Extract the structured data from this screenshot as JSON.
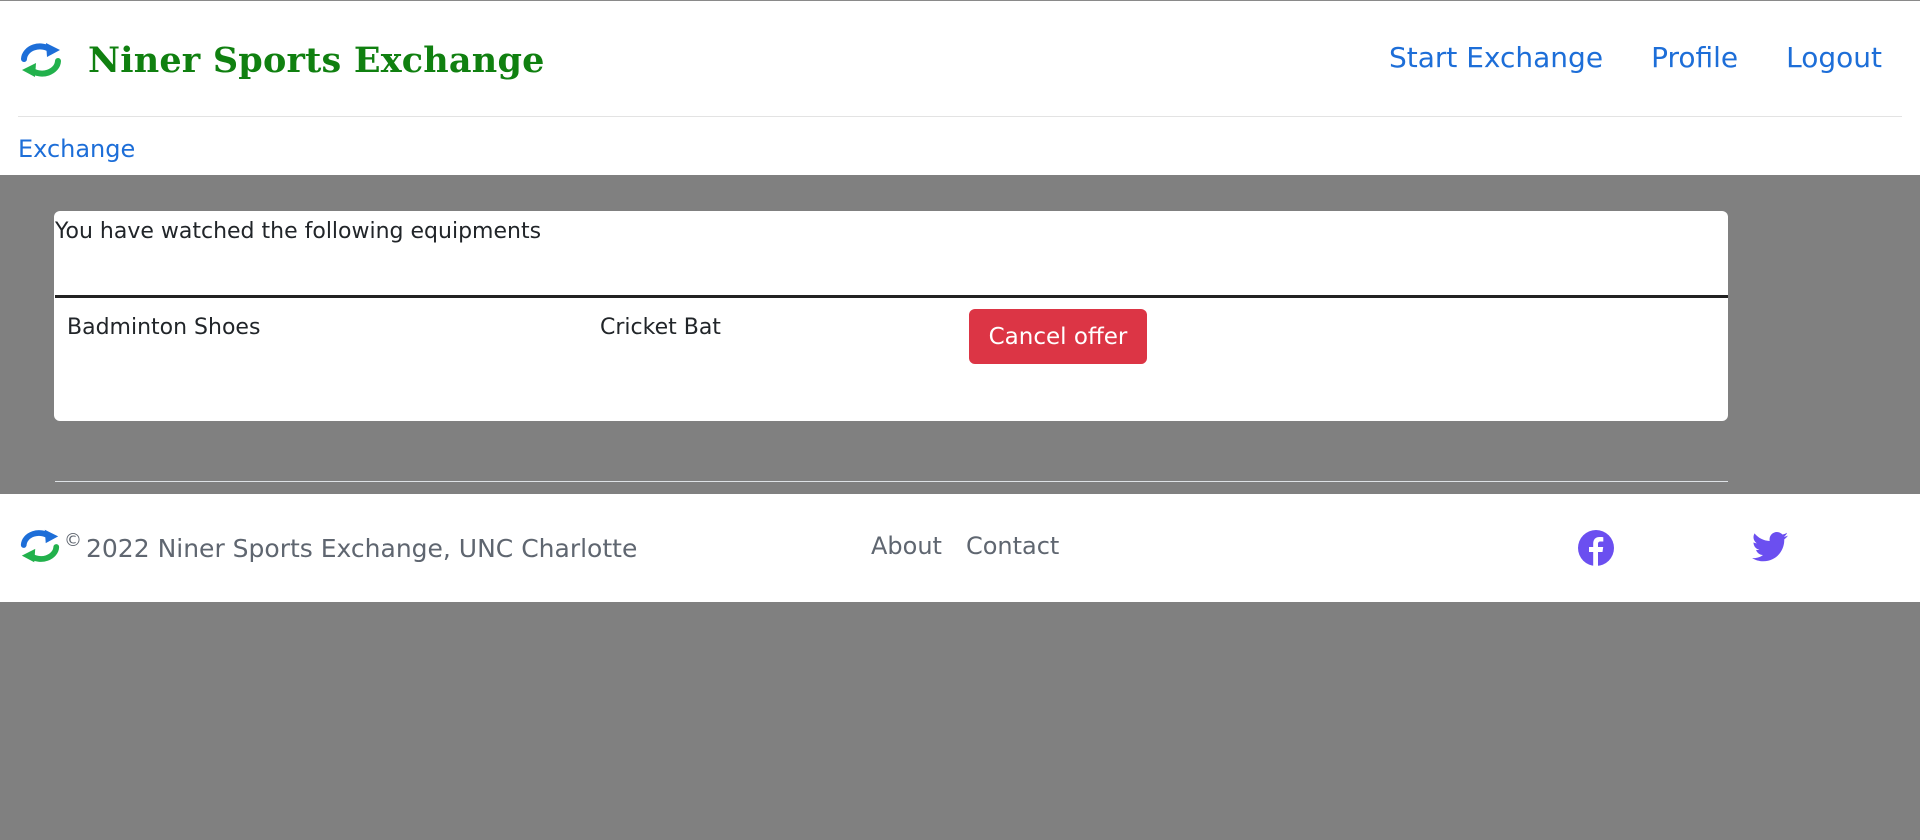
{
  "header": {
    "brand_title": "Niner Sports Exchange",
    "nav": [
      {
        "label": "Start Exchange"
      },
      {
        "label": "Profile"
      },
      {
        "label": "Logout"
      }
    ],
    "breadcrumb": "Exchange"
  },
  "card": {
    "heading": "You have watched the following equipments",
    "row": {
      "item_name": "Badminton Shoes",
      "item_category": "Cricket Bat",
      "action_label": "Cancel offer"
    }
  },
  "footer": {
    "copyright": "2022 Niner Sports Exchange, UNC Charlotte",
    "links": [
      {
        "label": "About"
      },
      {
        "label": "Contact"
      }
    ],
    "social": [
      "facebook-icon",
      "twitter-icon"
    ]
  },
  "colors": {
    "page_background": "#808080",
    "brand_green": "#108010",
    "link_blue": "#1d6ed8",
    "danger_red": "#dc3545",
    "social_purple": "#6b4ff0",
    "logo_blue": "#1d6ed8",
    "logo_green": "#22b14c"
  },
  "icons": {
    "logo": "exchange-arrows-icon"
  }
}
